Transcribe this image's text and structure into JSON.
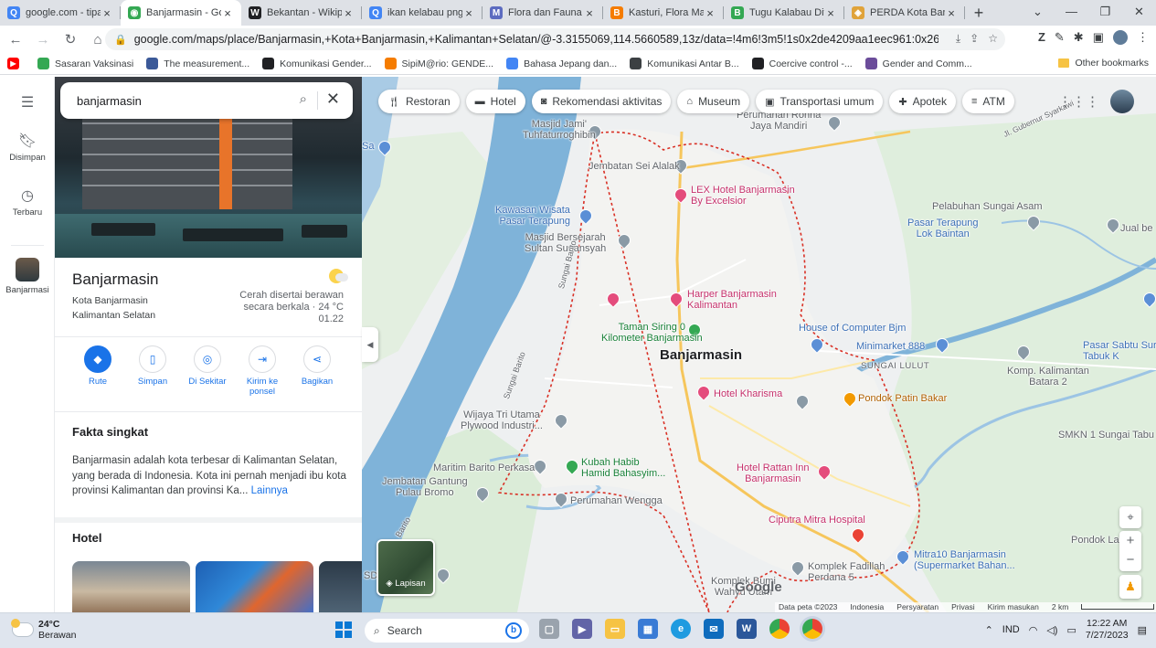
{
  "browser": {
    "tabs": [
      {
        "label": "google.com - tipa",
        "icon": "search-icon",
        "color": "#4285f4",
        "glyph": "Q"
      },
      {
        "label": "Banjarmasin - Go",
        "icon": "maps-icon",
        "color": "#34a853",
        "glyph": "◉",
        "active": true
      },
      {
        "label": "Bekantan - Wikip",
        "icon": "wikipedia-icon",
        "color": "#202124",
        "glyph": "W"
      },
      {
        "label": "ikan kelabau png",
        "icon": "search-icon",
        "color": "#4285f4",
        "glyph": "Q"
      },
      {
        "label": "Flora dan Fauna I",
        "icon": "site-icon",
        "color": "#5c6bc0",
        "glyph": "M"
      },
      {
        "label": "Kasturi, Flora Ma",
        "icon": "blogger-icon",
        "color": "#f57c00",
        "glyph": "B"
      },
      {
        "label": "Tugu Kalabau Dit",
        "icon": "site-icon",
        "color": "#34a853",
        "glyph": "B"
      },
      {
        "label": "PERDA Kota Banj",
        "icon": "site-icon",
        "color": "#e0a33a",
        "glyph": "◈"
      }
    ],
    "url": "google.com/maps/place/Banjarmasin,+Kota+Banjarmasin,+Kalimantan+Selatan/@-3.3155069,114.5660589,13z/data=!4m6!3m5!1s0x2de4209aa1eec961:0x26030bfcc092...",
    "bookmarks": [
      {
        "label": "",
        "icon": "youtube-icon",
        "color": "#ff0000"
      },
      {
        "label": "Sasaran Vaksinasi",
        "icon": "site-icon",
        "color": "#34a853"
      },
      {
        "label": "The measurement...",
        "icon": "site-icon",
        "color": "#3b5998"
      },
      {
        "label": "Komunikasi Gender...",
        "icon": "site-icon",
        "color": "#202124"
      },
      {
        "label": "SipiM@rio: GENDE...",
        "icon": "blogger-icon",
        "color": "#f57c00"
      },
      {
        "label": "Bahasa Jepang dan...",
        "icon": "google-icon",
        "color": "#4285f4"
      },
      {
        "label": "Komunikasi Antar B...",
        "icon": "site-icon",
        "color": "#3c4043"
      },
      {
        "label": "Coercive control -...",
        "icon": "site-icon",
        "color": "#202124"
      },
      {
        "label": "Gender and Comm...",
        "icon": "site-icon",
        "color": "#6b4c9a"
      }
    ],
    "other_bookmarks": "Other bookmarks"
  },
  "rail": {
    "items": [
      {
        "label": "",
        "icon": "menu-icon"
      },
      {
        "label": "Disimpan",
        "icon": "bookmark-icon"
      },
      {
        "label": "Terbaru",
        "icon": "history-icon"
      },
      {
        "label": "Banjarmasi",
        "icon": "recent-place-thumbnail"
      }
    ]
  },
  "panel": {
    "search_value": "banjarmasin",
    "place_name": "Banjarmasin",
    "subtitle_1": "Kota Banjarmasin",
    "subtitle_2": "Kalimantan Selatan",
    "weather_1": "Cerah disertai berawan",
    "weather_2": "secara berkala · 24 °C",
    "weather_3": "01.22",
    "actions": [
      {
        "label": "Rute",
        "icon": "directions-icon"
      },
      {
        "label": "Simpan",
        "icon": "bookmark-icon"
      },
      {
        "label": "Di Sekitar",
        "icon": "nearby-icon"
      },
      {
        "label": "Kirim ke ponsel",
        "icon": "send-to-phone-icon"
      },
      {
        "label": "Bagikan",
        "icon": "share-icon"
      }
    ],
    "fakta_title": "Fakta singkat",
    "description": "Banjarmasin adalah kota terbesar di Kalimantan Selatan, yang berada di Indonesia. Kota ini pernah menjadi ibu kota provinsi Kalimantan dan provinsi Ka...",
    "more_link": "Lainnya",
    "hotel_title": "Hotel"
  },
  "map": {
    "chips": [
      {
        "label": "Restoran",
        "icon": "restaurant-icon"
      },
      {
        "label": "Hotel",
        "icon": "hotel-icon"
      },
      {
        "label": "Rekomendasi aktivitas",
        "icon": "camera-icon"
      },
      {
        "label": "Museum",
        "icon": "museum-icon"
      },
      {
        "label": "Transportasi umum",
        "icon": "transit-icon"
      },
      {
        "label": "Apotek",
        "icon": "pharmacy-icon"
      },
      {
        "label": "ATM",
        "icon": "atm-icon"
      }
    ],
    "city_label": "Banjarmasin",
    "layers_label": "Lapisan",
    "google_logo": "Google",
    "attribution": [
      "Data peta ©2023",
      "Indonesia",
      "Persyaratan",
      "Privasi",
      "Kirim masukan",
      "2 km"
    ],
    "labels": {
      "masjid_jami": "Masjid Jami'\nTuhfaturroghibin",
      "perumahan_ronna": "Perumahan Ronna\nJaya Mandiri",
      "jembatan_alalak": "Jembatan Sei Alalak",
      "lex_hotel": "LEX Hotel Banjarmasin\nBy Excelsior",
      "pelabuhan": "Pelabuhan Sungai Asam",
      "kawasan_wisata": "Kawasan Wisata\nPasar Terapung",
      "masjid_bersejarah": "Masjid Bersejarah\nSultan Suriansyah",
      "pasar_terapung_lok": "Pasar Terapung\nLok Baintan",
      "harper": "Harper Banjarmasin\nKalimantan",
      "taman_siring": "Taman Siring 0\nKilometer Banjarmasin",
      "house_computer": "House of Computer Bjm",
      "minimarket": "Minimarket 888",
      "pasar_sabtu": "Pasar Sabtu Sur\nTabuk K",
      "komp_kalimantan": "Komp. Kalimantan\nBatara 2",
      "sungai_lulut": "SUNGAI LULUT",
      "hotel_kharisma": "Hotel Kharisma",
      "pondok_patin": "Pondok Patin Bakar",
      "wijaya": "Wijaya Tri Utama\nPlywood Industri...",
      "smkn": "SMKN 1 Sungai Tabu",
      "maritim": "Maritim Barito Perkasa",
      "kubah": "Kubah Habib\nHamid Bahasyim...",
      "hotel_rattan": "Hotel Rattan Inn\nBanjarmasin",
      "jembatan_gantung": "Jembatan Gantung\nPulau Bromo",
      "perumahan_wengga": "Perumahan Wengga",
      "ciputra": "Ciputra Mitra Hospital",
      "mitra10": "Mitra10 Banjarmasin\n(Supermarket Bahan...",
      "pondok_laut": "Pondok Laut",
      "komplek_fadillah": "Komplek Fadillah\nPerdana 5",
      "komplek_bumi": "Komplek Bumi\nWahyu Utam",
      "jual_be": "Jual be",
      "sungai_barito_1": "Sungai Barito",
      "sungai_barito_2": "Sungai Barito",
      "jl_gubernur": "Jl. Gubernur Syarkawi",
      "sd": "SD",
      "barito_edge": "Barito",
      "sa_edge": "Sa"
    }
  },
  "taskbar": {
    "temp": "24°C",
    "condition": "Berawan",
    "search": "Search",
    "lang": "IND",
    "time": "12:22 AM",
    "date": "7/27/2023"
  }
}
